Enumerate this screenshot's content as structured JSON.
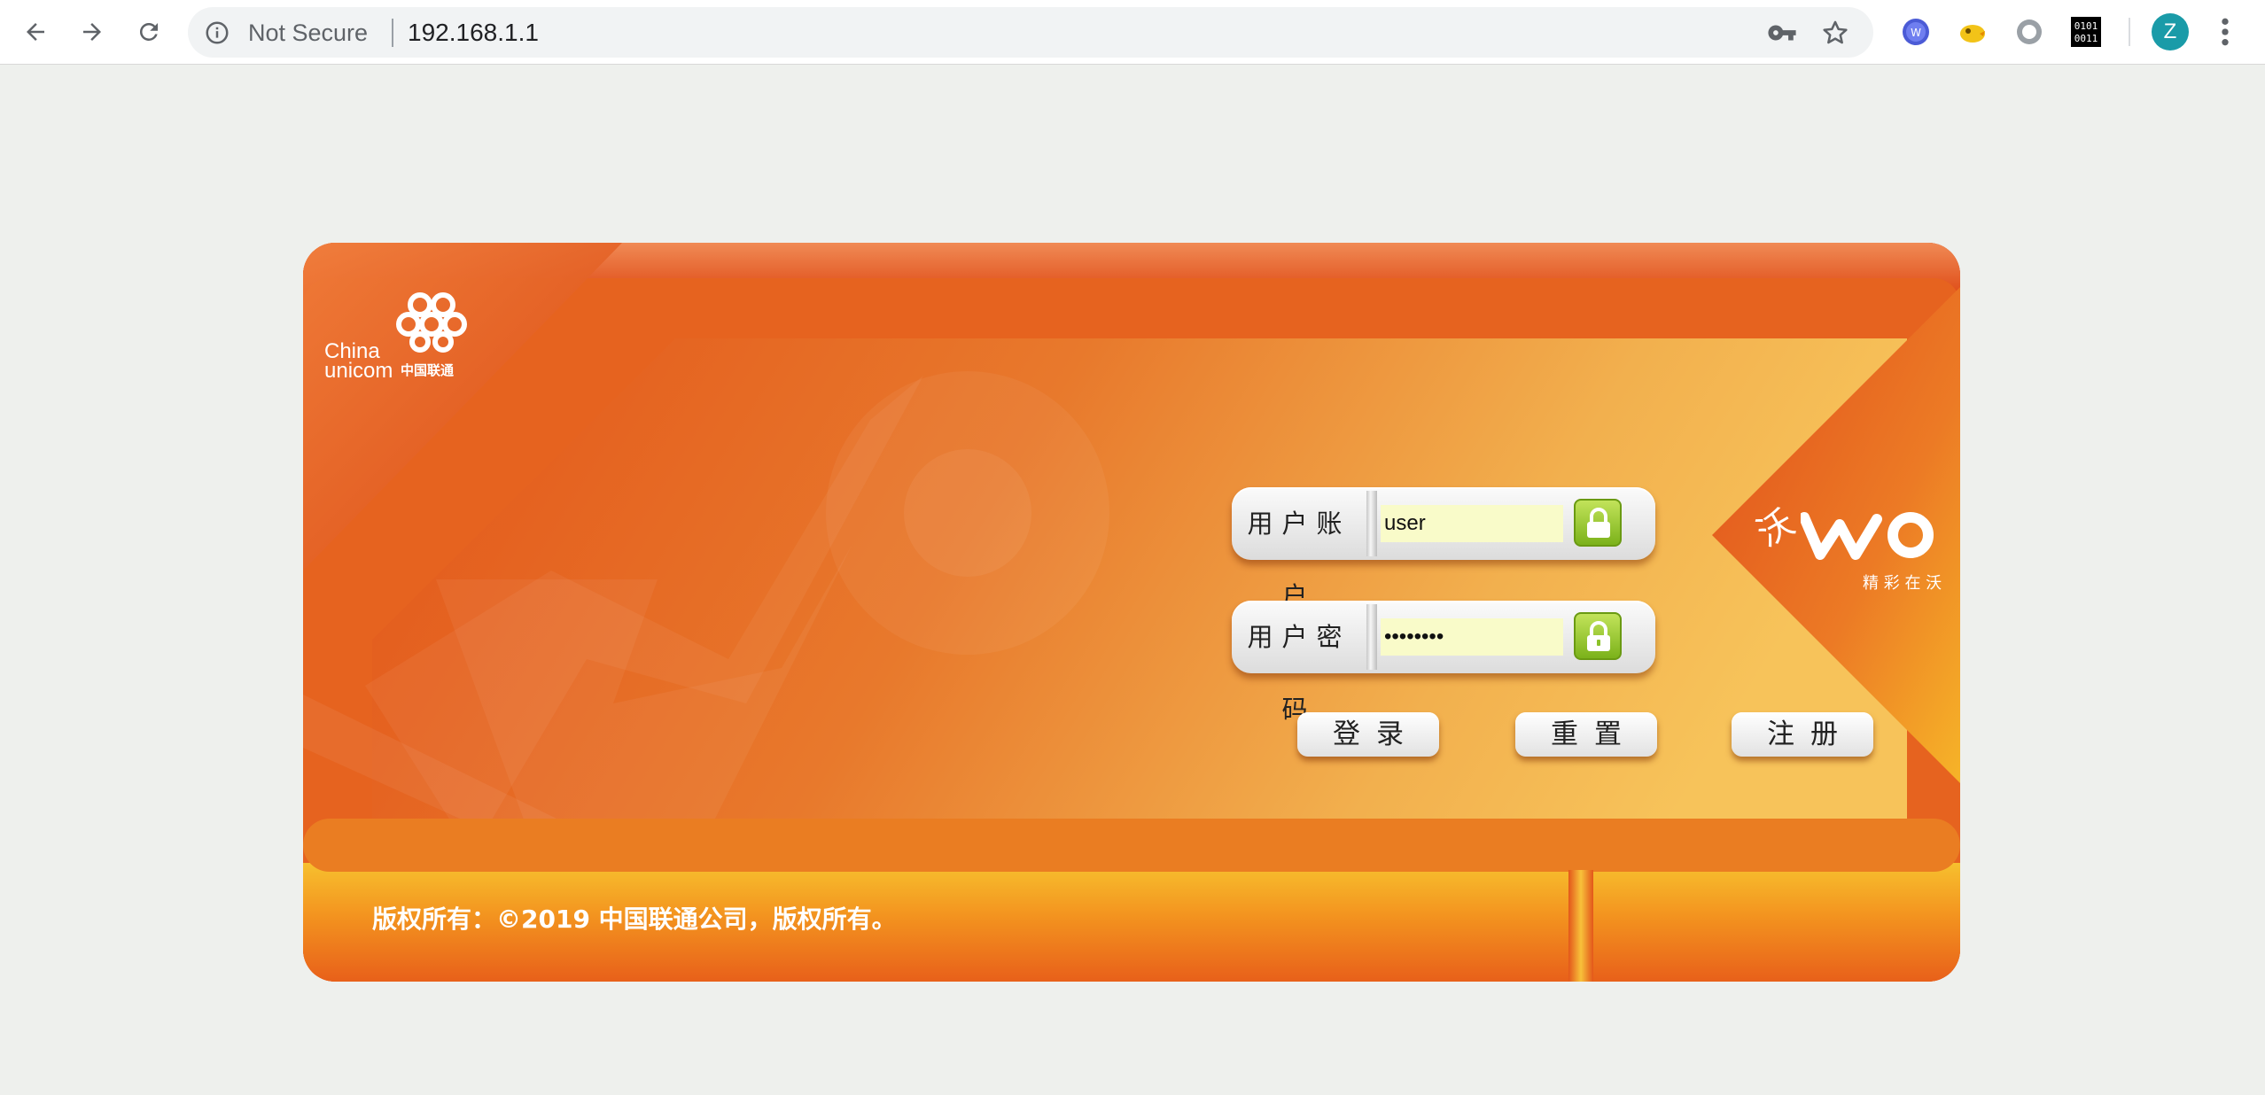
{
  "browser": {
    "security_label": "Not Secure",
    "url": "192.168.1.1",
    "icons": {
      "back": "arrow-left-icon",
      "forward": "arrow-right-icon",
      "reload": "reload-icon",
      "info": "info-icon",
      "key": "key-icon",
      "bookmark": "star-icon",
      "menu": "kebab-menu-icon"
    },
    "extensions": [
      "wappalyzer-extension-icon",
      "chick-extension-icon",
      "circle-extension-icon",
      "binary-extension-icon"
    ],
    "profile_initial": "Z",
    "profile_color": "#1a9ba8"
  },
  "brand": {
    "logo_en_line1": "China",
    "logo_en_line2": "unicom",
    "logo_cn": "中国联通",
    "slogan": "精 彩 在 沃",
    "wo_char": "沃"
  },
  "login": {
    "username_label": "用户账户",
    "username_value": "user",
    "password_label": "用户密码",
    "password_value": "••••••••",
    "login_button": "登录",
    "reset_button": "重置",
    "register_button": "注册"
  },
  "footer": {
    "copyright": "版权所有：©2019 中国联通公司，版权所有。"
  },
  "colors": {
    "page_bg": "#eef0ed",
    "panel_orange": "#e35a1c",
    "accent_yellow": "#f6c33a",
    "input_bg": "#f9fbc9",
    "lock_green": "#8cc22a"
  }
}
